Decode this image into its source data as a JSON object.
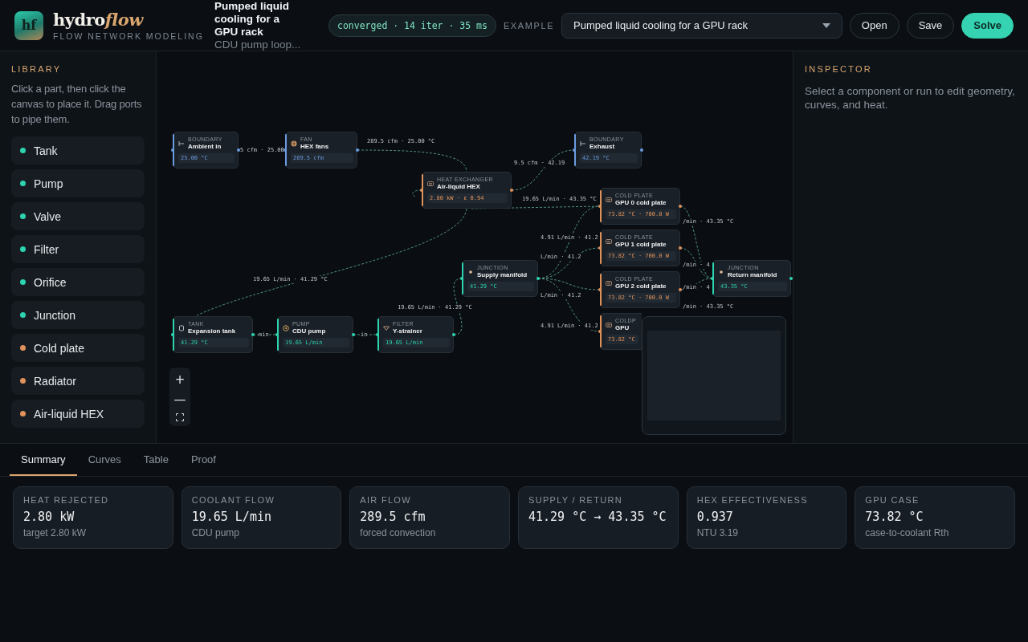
{
  "app": {
    "logo": "hf",
    "name": {
      "main": "hydro",
      "accent": "flow"
    },
    "tagline": "FLOW NETWORK MODELING"
  },
  "project": {
    "title": "Pumped liquid cooling for a GPU rack",
    "subtitle": "CDU pump loop..."
  },
  "status": "converged · 14 iter · 35 ms",
  "example": {
    "label": "EXAMPLE",
    "value": "Pumped liquid cooling for a GPU rack"
  },
  "buttons": [
    {
      "label": "Open",
      "kind": "default"
    },
    {
      "label": "Save",
      "kind": "default"
    },
    {
      "label": "Solve",
      "kind": "primary"
    }
  ],
  "library": {
    "title": "LIBRARY",
    "hint": "Click a part, then click the canvas to place it. Drag ports to pipe them.",
    "items": [
      {
        "label": "Tank",
        "color": "#2dd4b0"
      },
      {
        "label": "Pump",
        "color": "#2dd4b0"
      },
      {
        "label": "Valve",
        "color": "#2dd4b0"
      },
      {
        "label": "Filter",
        "color": "#2dd4b0"
      },
      {
        "label": "Orifice",
        "color": "#2dd4b0"
      },
      {
        "label": "Junction",
        "color": "#2dd4b0"
      },
      {
        "label": "Cold plate",
        "color": "#e0925a"
      },
      {
        "label": "Radiator",
        "color": "#e0925a"
      },
      {
        "label": "Air-liquid HEX",
        "color": "#e0925a"
      }
    ]
  },
  "canvas": {
    "nodes": [
      {
        "kind": "boundary",
        "type": "BOUNDARY",
        "name": "Ambient in",
        "reading": "25.00 °C",
        "color": "#6b9be0"
      },
      {
        "kind": "fan",
        "type": "FAN",
        "name": "HEX fans",
        "reading": "289.5 cfm",
        "color": "#6b9be0"
      },
      {
        "kind": "boundary",
        "type": "BOUNDARY",
        "name": "Exhaust",
        "reading": "42.19 °C",
        "color": "#6b9be0"
      },
      {
        "kind": "heat_exchanger",
        "type": "HEAT EXCHANGER",
        "name": "Air-liquid HEX",
        "reading": "2.80 kW · ε 0.94",
        "color": "#e0925a"
      },
      {
        "kind": "cold_plate",
        "type": "COLD PLATE",
        "name": "GPU 0 cold plate",
        "reading": "73.82 °C · 700.0 W",
        "color": "#e0925a"
      },
      {
        "kind": "cold_plate",
        "type": "COLD PLATE",
        "name": "GPU 1 cold plate",
        "reading": "73.82 °C · 700.0 W",
        "color": "#e0925a"
      },
      {
        "kind": "junction",
        "type": "JUNCTION",
        "name": "Supply manifold",
        "reading": "41.29 °C",
        "color": "#2dd4b0"
      },
      {
        "kind": "junction",
        "type": "JUNCTION",
        "name": "Return manifold",
        "reading": "43.35 °C",
        "color": "#2dd4b0"
      },
      {
        "kind": "cold_plate",
        "type": "COLD PLATE",
        "name": "GPU 2 cold plate",
        "reading": "73.82 °C · 700.0 W",
        "color": "#e0925a"
      },
      {
        "kind": "cold_plate",
        "type": "COLDP",
        "name": "GPU",
        "reading": "73.82 °C",
        "color": "#e0925a"
      },
      {
        "kind": "tank",
        "type": "TANK",
        "name": "Expansion tank",
        "reading": "41.29 °C",
        "color": "#2dd4b0"
      },
      {
        "kind": "pump",
        "type": "PUMP",
        "name": "CDU pump",
        "reading": "19.65 L/min",
        "color": "#2dd4b0"
      },
      {
        "kind": "filter",
        "type": "FILTER",
        "name": "Y-strainer",
        "reading": "19.65 L/min",
        "color": "#2dd4b0"
      }
    ],
    "pipe_labels": [
      "5 cfm · 25.00",
      "289.5 cfm · 25.00 °C",
      "9.5 cfm · 42.19",
      "19.65 L/min · 43.35 °C",
      "4.91 L/min · 41.2",
      "/min · 43.35 °C",
      "L/min · 41.2",
      "/min · 4",
      "L/min · 41.2",
      "/min · 4",
      "4.91 L/min · 41.2",
      "/min · 43.35 °C",
      "19.65 L/min · 41.29 °C",
      "19.65 L/min · 41.29 °C",
      "min",
      "in"
    ],
    "zoom": {
      "in": "+",
      "out": "—"
    }
  },
  "inspector": {
    "title": "INSPECTOR",
    "hint": "Select a component or run to edit geometry, curves, and heat."
  },
  "tabs": [
    {
      "label": "Summary",
      "selected": true
    },
    {
      "label": "Curves",
      "selected": false
    },
    {
      "label": "Table",
      "selected": false
    },
    {
      "label": "Proof",
      "selected": false
    }
  ],
  "cards": [
    {
      "title": "HEAT REJECTED",
      "value": "2.80 kW",
      "note": "target 2.80 kW"
    },
    {
      "title": "COOLANT FLOW",
      "value": "19.65 L/min",
      "note": "CDU pump"
    },
    {
      "title": "AIR FLOW",
      "value": "289.5 cfm",
      "note": "forced convection"
    },
    {
      "title": "SUPPLY / RETURN",
      "value": "41.29 °C → 43.35 °C"
    },
    {
      "title": "HEX EFFECTIVENESS",
      "value": "0.937",
      "note": "NTU 3.19"
    },
    {
      "title": "GPU CASE",
      "value": "73.82 °C",
      "note": "case-to-coolant Rth"
    }
  ]
}
